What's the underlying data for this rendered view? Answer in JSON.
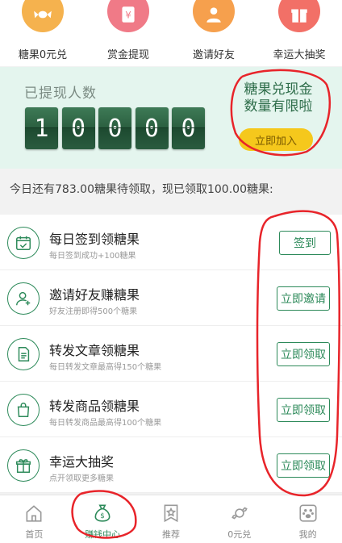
{
  "top_menu": [
    {
      "label": "糖果0元兑",
      "icon": "candy-icon",
      "color": "#f5b24e"
    },
    {
      "label": "赏金提现",
      "icon": "yen-icon",
      "color": "#f07a87"
    },
    {
      "label": "邀请好友",
      "icon": "person-icon",
      "color": "#f6a04d"
    },
    {
      "label": "幸运大抽奖",
      "icon": "gift-icon",
      "color": "#f27067"
    }
  ],
  "banner": {
    "title": "已提现人数",
    "digits": [
      "1",
      "0",
      "0",
      "0",
      "0"
    ],
    "promo_line1": "糖果兑现金",
    "promo_line2": "数量有限啦",
    "join_label": "立即加入"
  },
  "notice": "今日还有783.00糖果待领取，现已领取100.00糖果:",
  "tasks": [
    {
      "title": "每日签到领糖果",
      "desc": "每日签到成功+100糖果",
      "button": "签到",
      "icon": "calendar-check-icon"
    },
    {
      "title": "邀请好友赚糖果",
      "desc": "好友注册即得500个糖果",
      "button": "立即邀请",
      "icon": "add-user-icon"
    },
    {
      "title": "转发文章领糖果",
      "desc": "每日转发文章最高得150个糖果",
      "button": "立即领取",
      "icon": "document-icon"
    },
    {
      "title": "转发商品领糖果",
      "desc": "每日转发商品最高得100个糖果",
      "button": "立即领取",
      "icon": "shopping-bag-icon"
    },
    {
      "title": "幸运大抽奖",
      "desc": "点开领取更多糖果",
      "button": "立即领取",
      "icon": "gift-icon"
    }
  ],
  "bottom_nav": [
    {
      "label": "首页",
      "icon": "home-icon",
      "active": false
    },
    {
      "label": "赚钱中心",
      "icon": "money-bag-icon",
      "active": true
    },
    {
      "label": "推荐",
      "icon": "star-bookmark-icon",
      "active": false
    },
    {
      "label": "0元兑",
      "icon": "candy-icon",
      "active": false
    },
    {
      "label": "我的",
      "icon": "paw-icon",
      "active": false
    }
  ],
  "colors": {
    "accent": "#2d8a5a",
    "banner_bg": "#e4f5ee",
    "join_button": "#f5c81c",
    "annotation": "#e8242a"
  }
}
